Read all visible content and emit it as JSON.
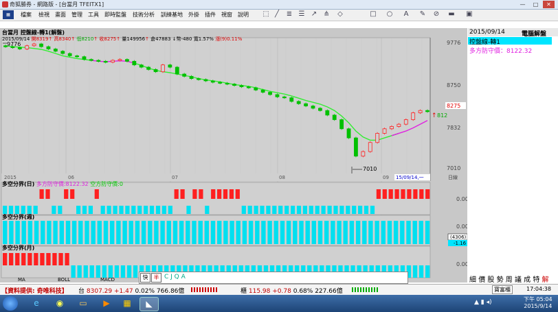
{
  "window": {
    "title": "奇狐勝券 - 網路版 - [台當月 TFEITX1]",
    "controls": [
      "—",
      "□",
      "✕"
    ]
  },
  "menu": {
    "items": [
      "檔案",
      "檢視",
      "畫面",
      "管理",
      "工具",
      "即時監盤",
      "技術分析",
      "訓練基地",
      "外掛",
      "插件",
      "視窗",
      "說明"
    ]
  },
  "toolbar": {
    "icons": [
      "select-icon",
      "line-icon",
      "parallel-icon",
      "fibonacci-icon",
      "arrow-icon",
      "pitchfork-icon",
      "rectangle-icon",
      "ellipse-icon",
      "text-icon",
      "eraser-icon",
      "palette-icon",
      "grid-icon",
      "save-icon"
    ]
  },
  "main_chart": {
    "title_line": "台當月 控盤線-轉1(解盤)",
    "quote": {
      "date": "2015/09/14",
      "open": "開8319",
      "open_arrow": "↑",
      "high": "高8340",
      "high_arrow": "↑",
      "low": "低8210",
      "low_arrow": "↑",
      "close": "收8275",
      "close_arrow": "↑",
      "volume": "量149956",
      "volume_arrow": "↑",
      "oi": "倉47883",
      "change": "↓幣-480",
      "ratio": "寬1.57%",
      "extra": "漲(9)0.11%"
    },
    "price_labels": {
      "high_label": "9776",
      "low_label": "7010"
    },
    "y_axis_ticks": [
      "9776",
      "8750",
      "8275",
      "7832",
      "7010"
    ],
    "x_axis_labels": [
      "2015",
      "06",
      "07",
      "08",
      "09"
    ],
    "cursor_date": "15/09/14,一",
    "right_axis_label": "日線",
    "current_price_tag": "8275",
    "current_price_side": "812"
  },
  "chart_data": {
    "type": "candlestick",
    "period": "daily",
    "x_range": [
      "2015-05",
      "2015-09-14"
    ],
    "ylim": [
      7010,
      9776
    ],
    "candles_close_estimate": [
      9700,
      9680,
      9650,
      9720,
      9760,
      9700,
      9650,
      9600,
      9550,
      9500,
      9480,
      9420,
      9400,
      9380,
      9360,
      9400,
      9420,
      9380,
      9300,
      9250,
      9200,
      9150,
      9300,
      9250,
      9100,
      9050,
      9000,
      8980,
      8950,
      8920,
      8900,
      8880,
      8850,
      8820,
      8800,
      8750,
      8700,
      8650,
      8600,
      8580,
      8500,
      8450,
      8400,
      8350,
      8300,
      8200,
      8100,
      7900,
      7700,
      7300,
      7400,
      7600,
      7800,
      7900,
      7950,
      8000,
      8100,
      8250,
      8300,
      8275
    ],
    "indicators": [
      {
        "name": "控盤線",
        "type": "line",
        "values": [
          9720,
          9700,
          9690,
          9680,
          9660,
          9640,
          9600,
          9550,
          9500,
          9470,
          9440,
          9420,
          9400,
          9380,
          9370,
          9380,
          9390,
          9380,
          9340,
          9290,
          9230,
          9180,
          9150,
          9130,
          9100,
          9070,
          9040,
          9000,
          8970,
          8950,
          8930,
          8900,
          8870,
          8850,
          8830,
          8800,
          8760,
          8720,
          8690,
          8660,
          8620,
          8570,
          8520,
          8480,
          8440,
          8380,
          8300,
          8180,
          8030,
          7850,
          7720,
          7650,
          7650,
          7700,
          7750,
          7800,
          7850,
          7920,
          8000,
          8080
        ]
      }
    ]
  },
  "sub_panels": [
    {
      "title": "多空分界(日)",
      "legend_bear": "多方防守價:8122.32",
      "legend_bull": "空方防守價:0",
      "axis_value": "0.00",
      "bars": "cbcbccrrcbrrccbrccccccccccccrrbrrbrrrrrccccccccccccccccccccccrrrrrrrrr"
    },
    {
      "title": "多空分界(週)",
      "axis_value": "0.00",
      "axis_box": "(4306)",
      "axis_value2": "-1.16",
      "bars": "cccccccccccccccccccccccccccccccccccccccccccccccccccccccccccccccccccc"
    },
    {
      "title": "多空分界(月)",
      "axis_value": "0.00",
      "bars": "rrrrrrrrrrrbbbbbbbccccccccccccccccccccccccccccccccccccccccccccccccccc"
    }
  ],
  "bottom_tabs": [
    "MA",
    "BOLL",
    "MACD"
  ],
  "input_box": {
    "mode_buttons": [
      "快",
      "半"
    ],
    "text": "C J Q A"
  },
  "right_panel": {
    "date": "2015/09/14",
    "header_right": "電腦解盤",
    "indicator_name": "控盤線-轉1",
    "defense_label": "多方防守價：8122.32",
    "buttons": [
      "細",
      "價",
      "股",
      "勢",
      "周",
      "議",
      "成",
      "特",
      "解"
    ]
  },
  "status_bar": {
    "provider": "【資料提供: 奇唯科技】",
    "tw_label": "台",
    "tw_value": "8307.29",
    "tw_change": "+1.47",
    "tw_pct": "0.02%",
    "tw_volume": "766.86億",
    "otc_label": "櫃",
    "otc_value": "115.98",
    "otc_change": "+0.78",
    "otc_pct": "0.68%",
    "otc_volume": "227.66億",
    "account": "寶富櫃",
    "time": "17:04:38"
  },
  "taskbar": {
    "clock_time": "下午 05:04",
    "clock_date": "2015/9/14",
    "apps": [
      "ie-icon",
      "explorer-icon",
      "media-icon",
      "chrome-icon",
      "folder-icon",
      "app-icon",
      "chart-app-icon"
    ]
  },
  "colors": {
    "up": "#ff2020",
    "down": "#00c000",
    "bull_bar": "#ff2020",
    "bear_bar": "#00e0f0",
    "ctrl_line_green": "#33ee33",
    "ctrl_line_magenta": "#e020e0",
    "right_panel_highlight": "#00e5ff"
  }
}
